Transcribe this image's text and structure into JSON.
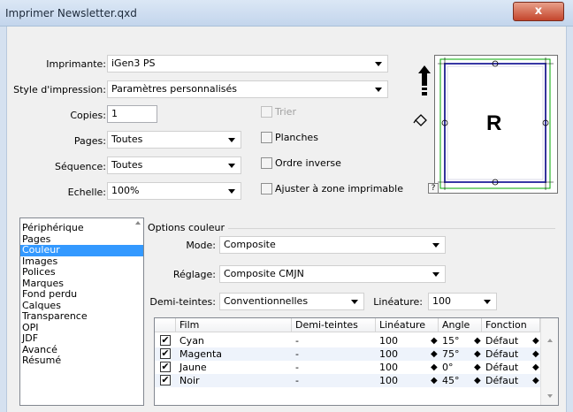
{
  "window": {
    "title": "Imprimer Newsletter.qxd",
    "close_glyph": "x"
  },
  "fields": {
    "printer": {
      "label": "Imprimante:",
      "value": "iGen3 PS"
    },
    "style": {
      "label": "Style d'impression:",
      "value": "Paramètres personnalisés"
    },
    "copies": {
      "label": "Copies:",
      "value": "1"
    },
    "pages": {
      "label": "Pages:",
      "value": "Toutes"
    },
    "sequence": {
      "label": "Séquence:",
      "value": "Toutes"
    },
    "scale": {
      "label": "Echelle:",
      "value": "100%"
    }
  },
  "checkboxes": {
    "collate": {
      "label": "Trier",
      "checked": false
    },
    "spreads": {
      "label": "Planches",
      "checked": false
    },
    "reverse": {
      "label": "Ordre inverse",
      "checked": false
    },
    "fit": {
      "label": "Ajuster à zone imprimable",
      "checked": false
    }
  },
  "preview": {
    "letter": "R",
    "help": "?"
  },
  "nav": {
    "items": [
      "Périphérique",
      "Pages",
      "Couleur",
      "Images",
      "Polices",
      "Marques",
      "Fond perdu",
      "Calques",
      "Transparence",
      "OPI",
      "JDF",
      "Avancé",
      "Résumé"
    ],
    "selected_index": 2
  },
  "color_options": {
    "group_title": "Options couleur",
    "mode": {
      "label": "Mode:",
      "value": "Composite"
    },
    "setup": {
      "label": "Réglage:",
      "value": "Composite CMJN"
    },
    "halftone": {
      "label": "Demi-teintes:",
      "value": "Conventionnelles"
    },
    "frequency": {
      "label": "Linéature:",
      "value": "100"
    }
  },
  "table": {
    "headers": {
      "film": "Film",
      "halftone": "Demi-teintes",
      "frequency": "Linéature",
      "angle": "Angle",
      "function": "Fonction"
    },
    "rows": [
      {
        "film": "Cyan",
        "halftone": "-",
        "frequency": "100",
        "angle": "15°",
        "function": "Défaut"
      },
      {
        "film": "Magenta",
        "halftone": "-",
        "frequency": "100",
        "angle": "75°",
        "function": "Défaut"
      },
      {
        "film": "Jaune",
        "halftone": "-",
        "frequency": "100",
        "angle": "0°",
        "function": "Défaut"
      },
      {
        "film": "Noir",
        "halftone": "-",
        "frequency": "100",
        "angle": "45°",
        "function": "Défaut"
      }
    ],
    "check_glyph": "✔",
    "spin_glyph": "◆"
  },
  "colors": {
    "selection": "#3399ff",
    "bleed_outline": "#00aa00",
    "page_outline": "#4b4bdc"
  }
}
